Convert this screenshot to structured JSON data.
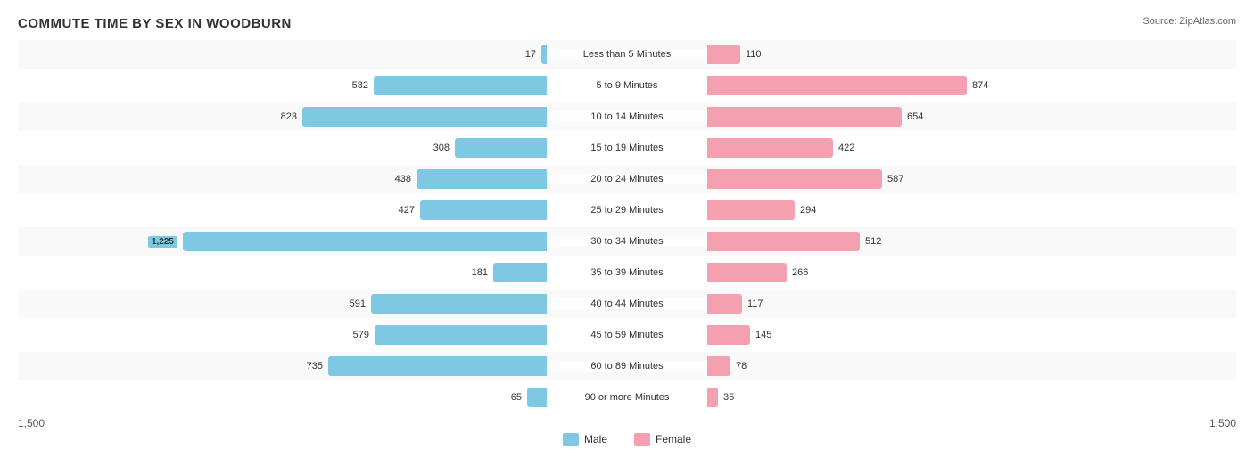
{
  "title": "COMMUTE TIME BY SEX IN WOODBURN",
  "source": "Source: ZipAtlas.com",
  "axis_left": "1,500",
  "axis_right": "1,500",
  "legend": {
    "male_label": "Male",
    "female_label": "Female"
  },
  "max_val": 1225,
  "scale_max": 1500,
  "rows": [
    {
      "label": "Less than 5 Minutes",
      "male": 17,
      "female": 110
    },
    {
      "label": "5 to 9 Minutes",
      "male": 582,
      "female": 874
    },
    {
      "label": "10 to 14 Minutes",
      "male": 823,
      "female": 654
    },
    {
      "label": "15 to 19 Minutes",
      "male": 308,
      "female": 422
    },
    {
      "label": "20 to 24 Minutes",
      "male": 438,
      "female": 587
    },
    {
      "label": "25 to 29 Minutes",
      "male": 427,
      "female": 294
    },
    {
      "label": "30 to 34 Minutes",
      "male": 1225,
      "female": 512
    },
    {
      "label": "35 to 39 Minutes",
      "male": 181,
      "female": 266
    },
    {
      "label": "40 to 44 Minutes",
      "male": 591,
      "female": 117
    },
    {
      "label": "45 to 59 Minutes",
      "male": 579,
      "female": 145
    },
    {
      "label": "60 to 89 Minutes",
      "male": 735,
      "female": 78
    },
    {
      "label": "90 or more Minutes",
      "male": 65,
      "female": 35
    }
  ]
}
